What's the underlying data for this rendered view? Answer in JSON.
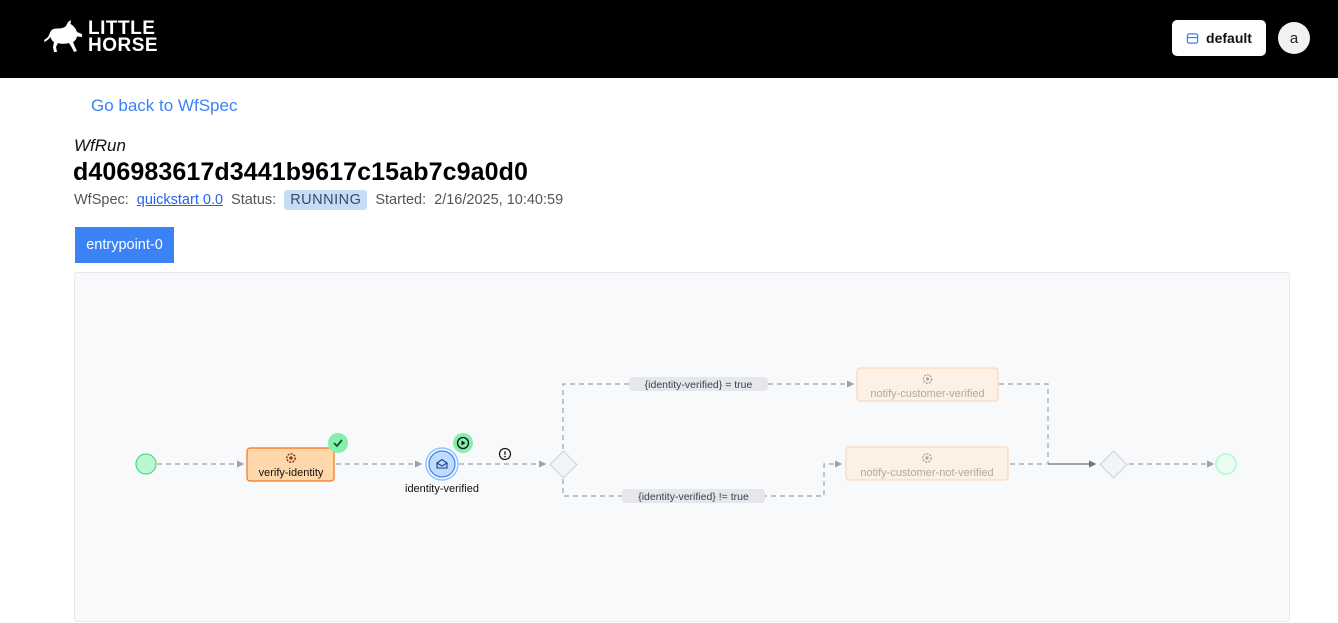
{
  "header": {
    "logo_line1": "LITTLE",
    "logo_line2": "HORSE",
    "tenant_label": "default",
    "avatar_initial": "a"
  },
  "nav": {
    "back_label": "Go back to WfSpec"
  },
  "run": {
    "kind": "WfRun",
    "id": "d406983617d3441b9617c15ab7c9a0d0",
    "wfspec_label": "WfSpec:",
    "wfspec_link": "quickstart 0.0",
    "status_label": "Status:",
    "status_value": "RUNNING",
    "started_label": "Started:",
    "started_value": "2/16/2025, 10:40:59"
  },
  "threads": [
    {
      "label": "entrypoint-0"
    }
  ],
  "graph": {
    "nodes": {
      "verify_identity": "verify-identity",
      "identity_verified": "identity-verified",
      "notify_verified": "notify-customer-verified",
      "notify_not_verified": "notify-customer-not-verified"
    },
    "edges": {
      "cond_true": "{identity-verified} = true",
      "cond_false": "{identity-verified} != true"
    },
    "colors": {
      "start": "#bbf7d0",
      "task_done": "#fed7aa",
      "task_pending": "#fdf1e6",
      "external_event": "#bfdbfe",
      "accent": "#3b82f6",
      "success": "#86efac"
    }
  }
}
